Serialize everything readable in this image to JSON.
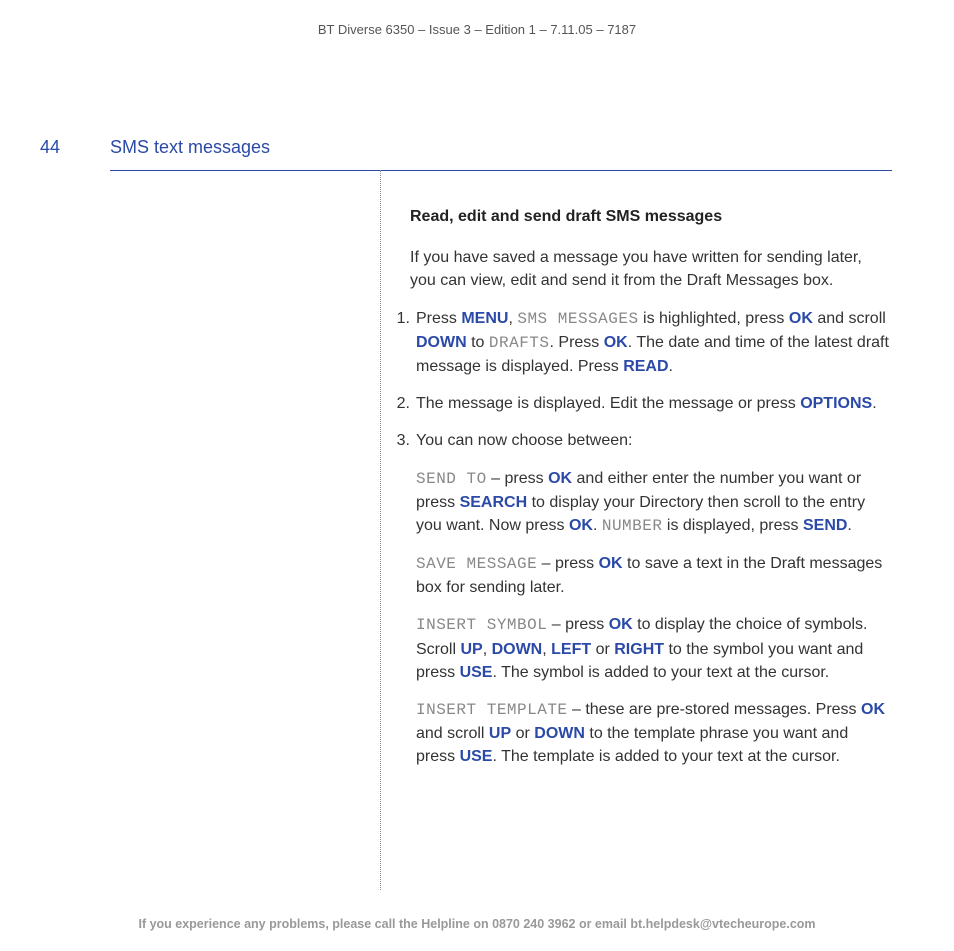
{
  "header": "BT Diverse 6350 – Issue 3 – Edition 1 – 7.11.05 – 7187",
  "page_number": "44",
  "section_title": "SMS text messages",
  "heading": "Read, edit and send draft SMS messages",
  "intro": "If you have saved a message you have written for sending later, you can view, edit and send it from the Draft Messages box.",
  "steps": {
    "s1": {
      "num": "1.",
      "t1": "Press ",
      "menu": "MENU",
      "t2": ", ",
      "sms": "SMS MESSAGES",
      "t3": " is highlighted, press ",
      "ok1": "OK",
      "t4": " and scroll ",
      "down": "DOWN",
      "t5": " to ",
      "drafts": "DRAFTS",
      "t6": ". Press ",
      "ok2": "OK",
      "t7": ". The date and time of the latest draft message is displayed. Press ",
      "read": "READ",
      "t8": "."
    },
    "s2": {
      "num": "2.",
      "t1": "The message is displayed. Edit the message or press ",
      "options": "OPTIONS",
      "t2": "."
    },
    "s3": {
      "num": "3.",
      "t1": "You can now choose between:"
    }
  },
  "options": {
    "sendto": {
      "lcd": "SEND TO",
      "t1": " – press ",
      "ok1": "OK",
      "t2": " and either enter the number you want or press ",
      "search": "SEARCH",
      "t3": " to display your Directory then scroll to the entry you want. Now press ",
      "ok2": "OK",
      "t4": ". ",
      "number": "NUMBER",
      "t5": " is displayed, press ",
      "send": "SEND",
      "t6": "."
    },
    "save": {
      "lcd": "SAVE MESSAGE",
      "t1": " – press ",
      "ok": "OK",
      "t2": " to save a text in the Draft messages box for sending later."
    },
    "symbol": {
      "lcd": "INSERT SYMBOL",
      "t1": " – press ",
      "ok": "OK",
      "t2": " to display the choice of symbols. Scroll ",
      "up": "UP",
      "t3": ", ",
      "down": "DOWN",
      "t4": ", ",
      "left": "LEFT",
      "t5": " or ",
      "right": "RIGHT",
      "t6": " to the symbol you want and press ",
      "use": "USE",
      "t7": ". The symbol is added to your text at the cursor."
    },
    "template": {
      "lcd": "INSERT TEMPLATE",
      "t1": " – these are pre-stored messages. Press ",
      "ok": "OK",
      "t2": " and scroll ",
      "up": "UP",
      "t3": " or ",
      "down": "DOWN",
      "t4": " to the template phrase you want and press ",
      "use": "USE",
      "t5": ". The template is added to your text at the cursor."
    }
  },
  "footer": {
    "t1": "If you experience any problems, please call the Helpline on ",
    "phone": "0870 240 3962",
    "t2": " or email ",
    "email": "bt.helpdesk@vtecheurope.com"
  }
}
